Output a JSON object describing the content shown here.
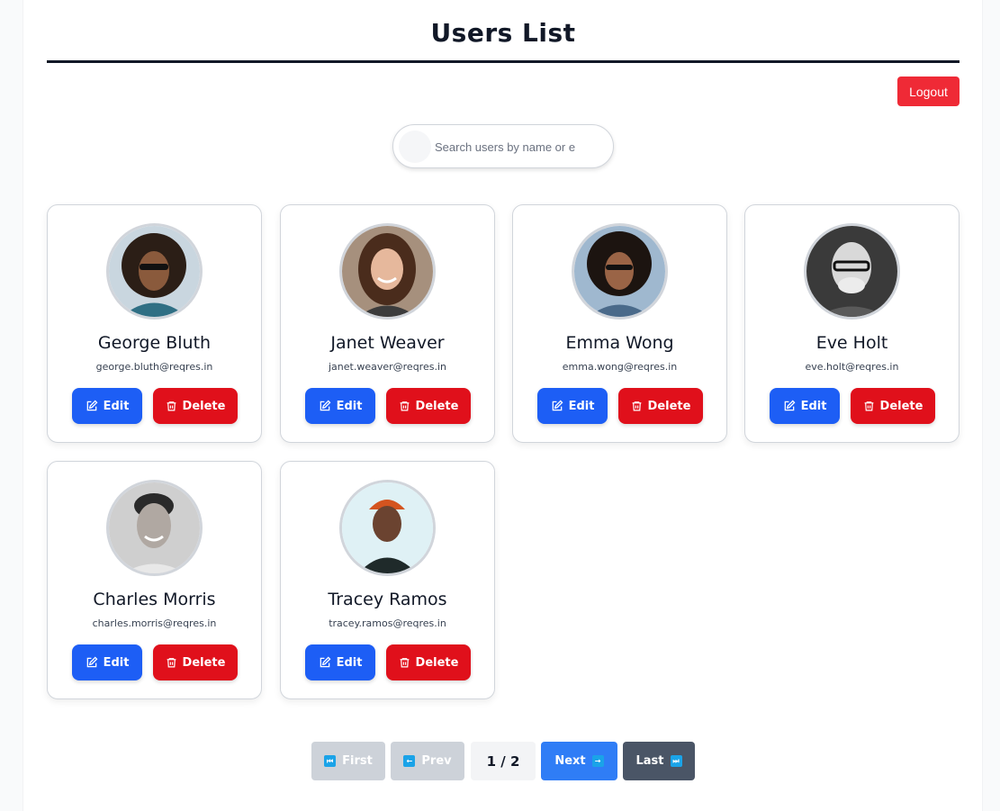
{
  "header": {
    "title": "Users List",
    "logout_label": "Logout"
  },
  "search": {
    "placeholder": "Search users by name or email"
  },
  "actions": {
    "edit_label": "Edit",
    "delete_label": "Delete"
  },
  "users": [
    {
      "name": "George Bluth",
      "email": "george.bluth@reqres.in"
    },
    {
      "name": "Janet Weaver",
      "email": "janet.weaver@reqres.in"
    },
    {
      "name": "Emma Wong",
      "email": "emma.wong@reqres.in"
    },
    {
      "name": "Eve Holt",
      "email": "eve.holt@reqres.in"
    },
    {
      "name": "Charles Morris",
      "email": "charles.morris@reqres.in"
    },
    {
      "name": "Tracey Ramos",
      "email": "tracey.ramos@reqres.in"
    }
  ],
  "pagination": {
    "first_label": "First",
    "prev_label": "Prev",
    "page_info": "1 / 2",
    "next_label": "Next",
    "last_label": "Last",
    "first_icon": "skip-first-icon",
    "prev_icon": "arrow-left-icon",
    "next_icon": "arrow-right-icon",
    "last_icon": "skip-last-icon"
  },
  "colors": {
    "edit": "#1d5ef5",
    "delete": "#e0101b",
    "logout": "#ef2a36",
    "next": "#2f7df6",
    "last": "#4a5566",
    "disabled": "#cdd2d9"
  }
}
